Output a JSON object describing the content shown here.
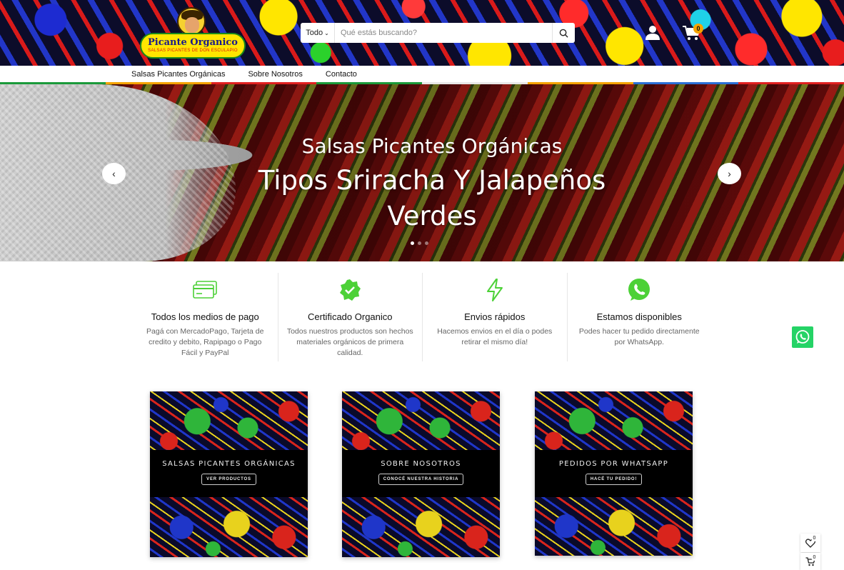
{
  "header": {
    "logo": {
      "title": "Picante Organico",
      "subtitle": "SALSAS PICANTES DE DON ESCULAPIO"
    },
    "search": {
      "category": "Todo",
      "placeholder": "Qué estás buscando?"
    },
    "cart_count": "0",
    "icons": {
      "search": "search-icon",
      "user": "user-icon",
      "cart": "cart-icon"
    }
  },
  "nav": {
    "items": [
      {
        "label": "Salsas Picantes Orgánicas"
      },
      {
        "label": "Sobre Nosotros"
      },
      {
        "label": "Contacto"
      }
    ],
    "stripe_colors": [
      "#1a9a3a",
      "#f5a300",
      "#e02020",
      "#1a9a3a",
      "#e8e8e8",
      "#f5a300",
      "#2a6fd6",
      "#e02020"
    ]
  },
  "hero": {
    "subtitle": "Salsas Picantes Orgánicas",
    "title_line1": "Tipos Sriracha Y Jalapeños",
    "title_line2": "Verdes",
    "slides": 3,
    "active_slide": 1
  },
  "features": [
    {
      "icon": "credit-card-icon",
      "title": "Todos los medios de pago",
      "desc": "Pagá con MercadoPago, Tarjeta de credito y debito, Rapipago o Pago Fácil y PayPal"
    },
    {
      "icon": "verified-badge-icon",
      "title": "Certificado Organico",
      "desc": "Todos nuestros productos son hechos materiales orgánicos de primera calidad."
    },
    {
      "icon": "lightning-icon",
      "title": "Envios rápidos",
      "desc": "Hacemos envios en el día o podes retirar el mismo día!"
    },
    {
      "icon": "whatsapp-icon",
      "title": "Estamos disponibles",
      "desc": "Podes hacer tu pedido directamente por WhatsApp."
    }
  ],
  "cards": [
    {
      "title": "SALSAS PICANTES ORGÁNICAS",
      "button": "VER PRODUCTOS"
    },
    {
      "title": "SOBRE NOSOTROS",
      "button": "CONOCÉ NUESTRA HISTORIA"
    },
    {
      "title": "PEDIDOS POR WHATSAPP",
      "button": "HACÉ TU PEDIDO!"
    }
  ],
  "floating": {
    "wishlist_count": "0",
    "cart_count": "0"
  },
  "colors": {
    "accent_green": "#4cd137",
    "whatsapp": "#25d366",
    "badge_orange": "#f5a300"
  }
}
